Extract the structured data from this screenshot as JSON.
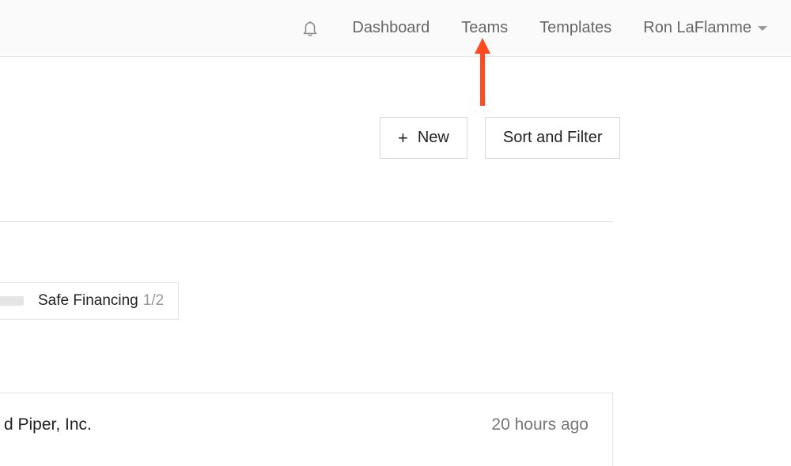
{
  "header": {
    "nav": {
      "dashboard": "Dashboard",
      "teams": "Teams",
      "templates": "Templates",
      "userName": "Ron LaFlamme"
    }
  },
  "actions": {
    "newLabel": "New",
    "sortFilterLabel": "Sort and Filter"
  },
  "tag": {
    "label": "Safe Financing",
    "count": "1/2"
  },
  "row": {
    "title": "d Piper, Inc.",
    "time": "20 hours ago"
  }
}
